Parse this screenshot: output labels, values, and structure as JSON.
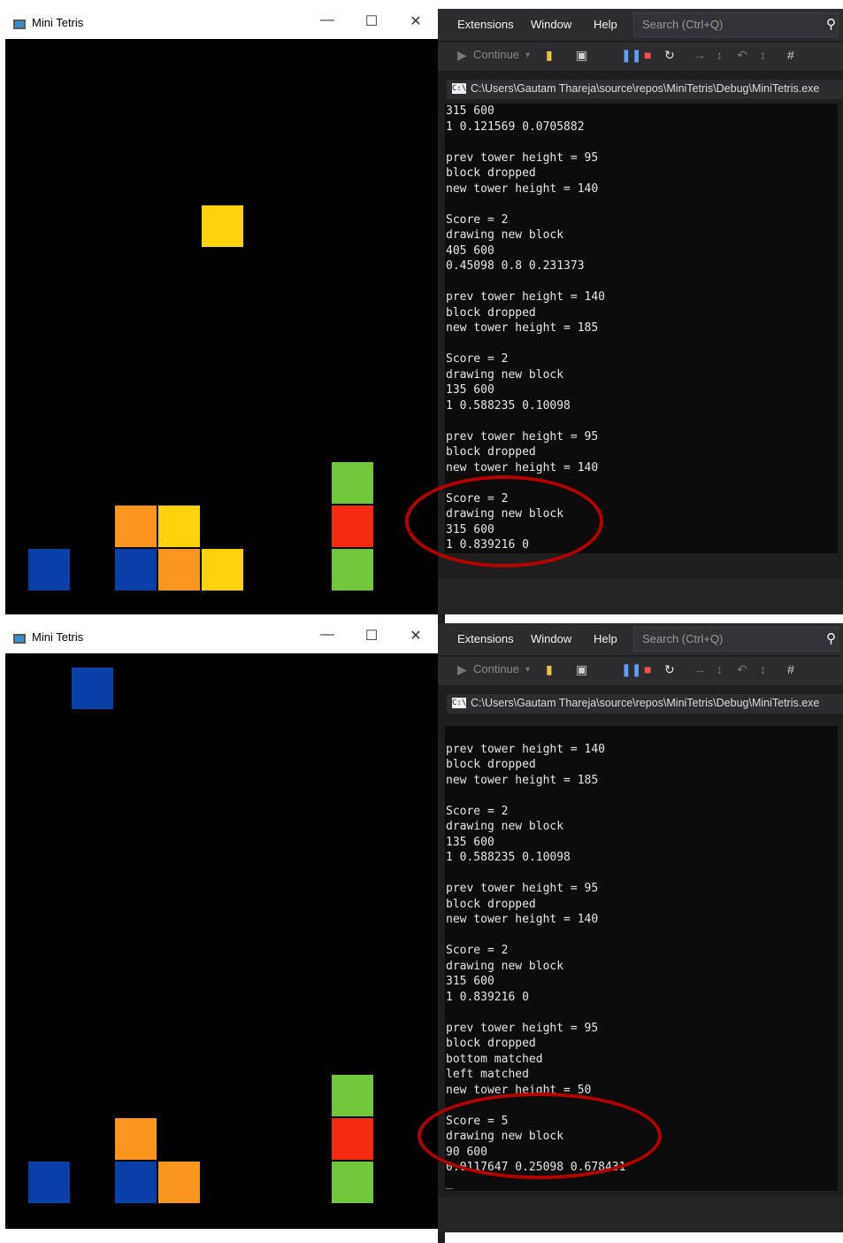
{
  "colors": {
    "blue": "#0a3fa8",
    "orange": "#fa961e",
    "yellow": "#ffd20a",
    "green": "#72c83c",
    "red": "#f52a10",
    "annotation": "#b40000"
  },
  "panels": [
    {
      "game": {
        "title": "Mini Tetris",
        "falling_block": "yellow",
        "tower_blocks": [
          "blue",
          "blue",
          "orange",
          "orange",
          "yellow",
          "yellow",
          "green",
          "red",
          "green"
        ]
      },
      "vs": {
        "menu": [
          "Extensions",
          "Window",
          "Help"
        ],
        "search_placeholder": "Search (Ctrl+Q)",
        "toolbar_continue": "Continue",
        "console_path": "C:\\Users\\Gautam Thareja\\source\\repos\\MiniTetris\\Debug\\MiniTetris.exe",
        "console_lines": [
          "315 600",
          "1 0.121569 0.0705882",
          "",
          "prev tower height = 95",
          "block dropped",
          "new tower height = 140",
          "",
          "Score = 2",
          "drawing new block",
          "405 600",
          "0.45098 0.8 0.231373",
          "",
          "prev tower height = 140",
          "block dropped",
          "new tower height = 185",
          "",
          "Score = 2",
          "drawing new block",
          "135 600",
          "1 0.588235 0.10098",
          "",
          "prev tower height = 95",
          "block dropped",
          "new tower height = 140",
          "",
          "Score = 2",
          "drawing new block",
          "315 600",
          "1 0.839216 0"
        ]
      }
    },
    {
      "game": {
        "title": "Mini Tetris",
        "falling_block": "blue",
        "tower_blocks": [
          "blue",
          "blue",
          "orange",
          "orange",
          "green",
          "red",
          "green"
        ]
      },
      "vs": {
        "menu": [
          "Extensions",
          "Window",
          "Help"
        ],
        "search_placeholder": "Search (Ctrl+Q)",
        "toolbar_continue": "Continue",
        "console_path": "C:\\Users\\Gautam Thareja\\source\\repos\\MiniTetris\\Debug\\MiniTetris.exe",
        "console_lines": [
          "",
          "prev tower height = 140",
          "block dropped",
          "new tower height = 185",
          "",
          "Score = 2",
          "drawing new block",
          "135 600",
          "1 0.588235 0.10098",
          "",
          "prev tower height = 95",
          "block dropped",
          "new tower height = 140",
          "",
          "Score = 2",
          "drawing new block",
          "315 600",
          "1 0.839216 0",
          "",
          "prev tower height = 95",
          "block dropped",
          "bottom matched",
          "left matched",
          "new tower height = 50",
          "",
          "Score = 5",
          "drawing new block",
          "90 600",
          "0.0117647 0.25098 0.678431",
          "_"
        ]
      }
    }
  ]
}
